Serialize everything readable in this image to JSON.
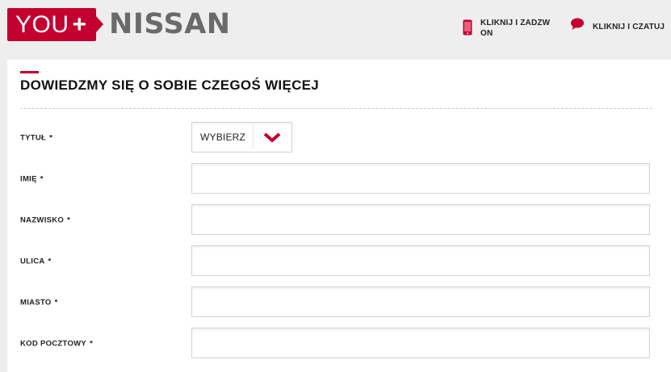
{
  "header": {
    "logo": {
      "you": "YOU",
      "plus": "+",
      "brand": "NISSAN"
    },
    "call_link": {
      "label": "KLIKNIJ I ZADZW\nON",
      "icon": "phone-icon"
    },
    "chat_link": {
      "label": "KLIKNIJ I CZATUJ",
      "icon": "chat-bubble-icon"
    }
  },
  "form": {
    "title": "DOWIEDZMY SIĘ O SOBIE CZEGOŚ WIĘCEJ",
    "fields": [
      {
        "label": "TYTUŁ",
        "required": "*",
        "type": "select",
        "value": "WYBIERZ"
      },
      {
        "label": "IMIĘ",
        "required": "*",
        "type": "text",
        "value": ""
      },
      {
        "label": "NAZWISKO",
        "required": "*",
        "type": "text",
        "value": ""
      },
      {
        "label": "ULICA",
        "required": "*",
        "type": "text",
        "value": ""
      },
      {
        "label": "MIASTO",
        "required": "*",
        "type": "text",
        "value": ""
      },
      {
        "label": "KOD POCZTOWY",
        "required": "*",
        "type": "text",
        "value": ""
      }
    ]
  },
  "colors": {
    "accent": "#c3002f",
    "brand_gray": "#6a6a6a",
    "background": "#eeeeee"
  }
}
